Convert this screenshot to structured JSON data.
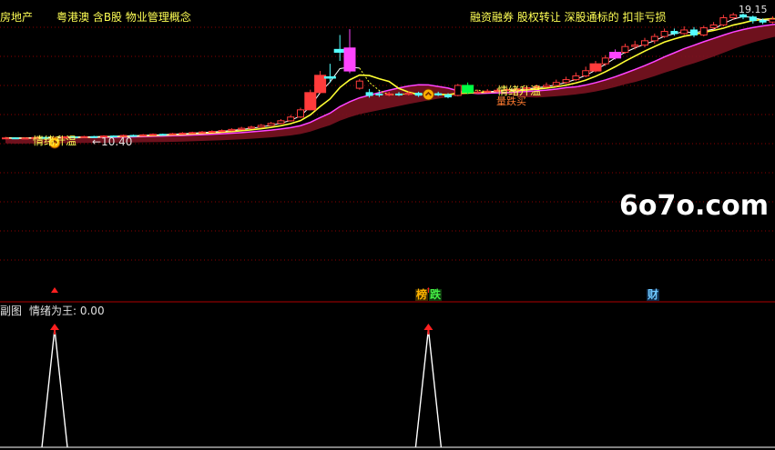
{
  "header": {
    "sector_label": "房地产",
    "tags_left": "粤港澳 含B股 物业管理概念",
    "tags_right": "融资融券 股权转让 深股通标的 扣非亏损",
    "high_price": "19.15"
  },
  "watermark": "6o7o.com",
  "main_panel": {
    "signal_label_1": "情绪升温",
    "signal_label_2": "情绪升温",
    "signal_label_2_sub": "量跌买",
    "low_price_marker": "←10.40"
  },
  "event_tags": [
    {
      "text": "榜",
      "color": "#ffb400"
    },
    {
      "text": "跌",
      "color": "#44ee44"
    },
    {
      "text": "财",
      "color": "#6fc8ff"
    }
  ],
  "sub_panel": {
    "title": "副图",
    "indicator_label": "情绪为王: 0.00"
  },
  "colors": {
    "up": "#ff3b3b",
    "down": "#54ffff",
    "ma_short": "#ffffff",
    "ma_yellow": "#ffff33",
    "ma_magenta": "#ff44ff",
    "band": "#7a1320",
    "grid": "#8b0000",
    "signal": "#ff2020"
  },
  "chart_data": {
    "type": "candlestick",
    "candles": [
      [
        10.4,
        10.45,
        10.52,
        10.36
      ],
      [
        10.45,
        10.42,
        10.5,
        10.38
      ],
      [
        10.42,
        10.44,
        10.5,
        10.38
      ],
      [
        10.44,
        10.48,
        10.55,
        10.4
      ],
      [
        10.48,
        10.46,
        10.53,
        10.42
      ],
      [
        10.46,
        10.5,
        10.56,
        10.44
      ],
      [
        10.5,
        10.52,
        10.58,
        10.46
      ],
      [
        10.52,
        10.5,
        10.57,
        10.46
      ],
      [
        10.5,
        10.54,
        10.6,
        10.47
      ],
      [
        10.54,
        10.53,
        10.6,
        10.49
      ],
      [
        10.53,
        10.58,
        10.64,
        10.5
      ],
      [
        10.58,
        10.56,
        10.63,
        10.52
      ],
      [
        10.56,
        10.62,
        10.68,
        10.53
      ],
      [
        10.62,
        10.6,
        10.68,
        10.56
      ],
      [
        10.6,
        10.66,
        10.72,
        10.57
      ],
      [
        10.66,
        10.7,
        10.76,
        10.62
      ],
      [
        10.7,
        10.68,
        10.75,
        10.64
      ],
      [
        10.68,
        10.74,
        10.8,
        10.65
      ],
      [
        10.74,
        10.78,
        10.85,
        10.7
      ],
      [
        10.78,
        10.82,
        10.88,
        10.74
      ],
      [
        10.82,
        10.86,
        10.93,
        10.78
      ],
      [
        10.86,
        10.9,
        10.98,
        10.82
      ],
      [
        10.9,
        10.96,
        11.04,
        10.86
      ],
      [
        10.96,
        11.04,
        11.12,
        10.92
      ],
      [
        11.04,
        11.12,
        11.22,
        11.0
      ],
      [
        11.12,
        11.2,
        11.3,
        11.08
      ],
      [
        11.2,
        11.32,
        11.42,
        11.16
      ],
      [
        11.32,
        11.46,
        11.56,
        11.28
      ],
      [
        11.46,
        11.64,
        11.76,
        11.4
      ],
      [
        11.64,
        11.9,
        12.05,
        11.58
      ],
      [
        11.9,
        12.4,
        12.55,
        11.84
      ],
      [
        12.4,
        13.6,
        13.8,
        12.36
      ],
      [
        13.6,
        14.8,
        15.1,
        13.5
      ],
      [
        14.7,
        14.6,
        15.6,
        14.3
      ],
      [
        16.6,
        16.4,
        17.6,
        15.8
      ],
      [
        16.7,
        15.1,
        18.0,
        14.95
      ],
      [
        13.9,
        14.4,
        14.55,
        13.8
      ],
      [
        13.6,
        13.4,
        13.85,
        13.25
      ],
      [
        13.5,
        13.45,
        13.7,
        13.3
      ],
      [
        13.45,
        13.5,
        13.65,
        13.35
      ],
      [
        13.5,
        13.48,
        13.64,
        13.36
      ],
      [
        13.48,
        13.55,
        13.7,
        13.4
      ],
      [
        13.55,
        13.42,
        13.66,
        13.3
      ],
      [
        13.42,
        13.52,
        13.64,
        13.32
      ],
      [
        13.52,
        13.44,
        13.66,
        13.36
      ],
      [
        13.44,
        13.3,
        13.56,
        13.2
      ],
      [
        13.4,
        14.1,
        14.2,
        13.34
      ],
      [
        14.1,
        13.6,
        14.3,
        13.5
      ],
      [
        13.6,
        13.64,
        13.8,
        13.52
      ],
      [
        13.64,
        13.7,
        13.84,
        13.58
      ],
      [
        13.7,
        13.76,
        13.9,
        13.64
      ],
      [
        13.76,
        13.8,
        13.94,
        13.7
      ],
      [
        13.8,
        13.86,
        14.0,
        13.72
      ],
      [
        13.86,
        13.94,
        14.08,
        13.8
      ],
      [
        13.94,
        14.0,
        14.16,
        13.86
      ],
      [
        14.0,
        14.1,
        14.3,
        13.94
      ],
      [
        14.1,
        14.3,
        14.5,
        14.0
      ],
      [
        14.3,
        14.5,
        14.7,
        14.2
      ],
      [
        14.5,
        14.76,
        15.0,
        14.4
      ],
      [
        14.76,
        15.12,
        15.4,
        14.66
      ],
      [
        15.1,
        15.6,
        15.8,
        15.0
      ],
      [
        15.6,
        16.0,
        16.2,
        15.45
      ],
      [
        16.0,
        16.4,
        16.6,
        15.9
      ],
      [
        16.4,
        16.8,
        17.0,
        16.3
      ],
      [
        16.8,
        16.9,
        17.2,
        16.6
      ],
      [
        16.9,
        17.2,
        17.4,
        16.75
      ],
      [
        17.2,
        17.5,
        17.7,
        17.0
      ],
      [
        17.5,
        17.85,
        18.05,
        17.4
      ],
      [
        17.85,
        17.7,
        18.05,
        17.55
      ],
      [
        17.7,
        17.95,
        18.2,
        17.6
      ],
      [
        17.95,
        17.6,
        18.15,
        17.45
      ],
      [
        17.6,
        18.1,
        18.25,
        17.5
      ],
      [
        18.1,
        18.3,
        18.5,
        18.0
      ],
      [
        18.3,
        18.8,
        19.0,
        18.2
      ],
      [
        18.8,
        19.0,
        19.15,
        18.65
      ],
      [
        19.0,
        18.85,
        19.1,
        18.7
      ],
      [
        18.85,
        18.6,
        18.95,
        18.4
      ],
      [
        18.6,
        18.5,
        18.75,
        18.35
      ],
      [
        18.5,
        18.7,
        18.9,
        18.4
      ],
      [
        18.7,
        18.4,
        18.85,
        18.3
      ]
    ],
    "hollow_up": [
      30,
      33,
      37,
      50,
      54
    ],
    "big_up": {
      "31": "#ff2020",
      "32": "#ff2020",
      "34": "#ff2020",
      "60": "#ff2020"
    },
    "special_colors": {
      "35": "#ff44ff",
      "47": "#00ff44",
      "33": "#54ffff",
      "62": "#ff44ff"
    },
    "signals": [
      5,
      43
    ],
    "sub_indicator": {
      "name": "情绪为王",
      "value": 0.0,
      "spikes_at": [
        5,
        43
      ]
    }
  }
}
